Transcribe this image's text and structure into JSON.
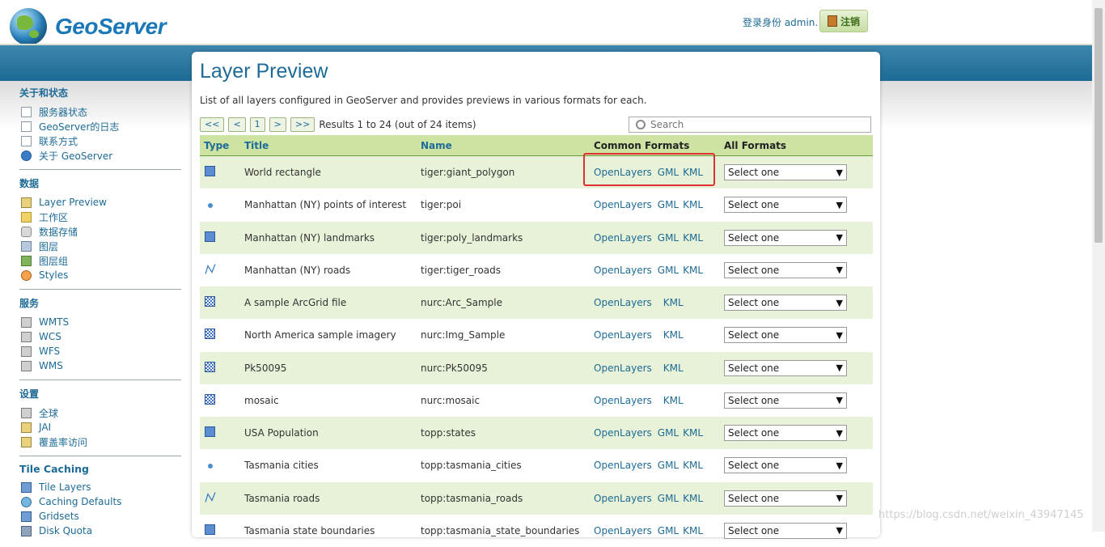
{
  "header": {
    "logo_text": "GeoServer",
    "login_info": "登录身份 admin.",
    "logout_label": "注销"
  },
  "sidebar": {
    "sections": [
      {
        "title": "关于和状态",
        "items": [
          "服务器状态",
          "GeoServer的日志",
          "联系方式",
          "关于 GeoServer"
        ]
      },
      {
        "title": "数据",
        "items": [
          "Layer Preview",
          "工作区",
          "数据存储",
          "图层",
          "图层组",
          "Styles"
        ]
      },
      {
        "title": "服务",
        "items": [
          "WMTS",
          "WCS",
          "WFS",
          "WMS"
        ]
      },
      {
        "title": "设置",
        "items": [
          "全球",
          "JAI",
          "覆盖率访问"
        ]
      },
      {
        "title": "Tile Caching",
        "items": [
          "Tile Layers",
          "Caching Defaults",
          "Gridsets",
          "Disk Quota"
        ]
      }
    ]
  },
  "main": {
    "title": "Layer Preview",
    "description": "List of all layers configured in GeoServer and provides previews in various formats for each.",
    "pager": {
      "first": "<<",
      "prev": "<",
      "page": "1",
      "next": ">",
      "last": ">>",
      "results": "Results 1 to 24 (out of 24 items)"
    },
    "search_placeholder": "Search",
    "columns": {
      "type": "Type",
      "title": "Title",
      "name": "Name",
      "common": "Common Formats",
      "all": "All Formats"
    },
    "select_default": "Select one",
    "rows": [
      {
        "type": "polygon",
        "title": "World rectangle",
        "name": "tiger:giant_polygon",
        "formats": [
          "OpenLayers",
          "GML",
          "KML"
        ]
      },
      {
        "type": "point",
        "title": "Manhattan (NY) points of interest",
        "name": "tiger:poi",
        "formats": [
          "OpenLayers",
          "GML",
          "KML"
        ]
      },
      {
        "type": "polygon",
        "title": "Manhattan (NY) landmarks",
        "name": "tiger:poly_landmarks",
        "formats": [
          "OpenLayers",
          "GML",
          "KML"
        ]
      },
      {
        "type": "line",
        "title": "Manhattan (NY) roads",
        "name": "tiger:tiger_roads",
        "formats": [
          "OpenLayers",
          "GML",
          "KML"
        ]
      },
      {
        "type": "raster",
        "title": "A sample ArcGrid file",
        "name": "nurc:Arc_Sample",
        "formats": [
          "OpenLayers",
          "",
          "KML"
        ]
      },
      {
        "type": "raster",
        "title": "North America sample imagery",
        "name": "nurc:Img_Sample",
        "formats": [
          "OpenLayers",
          "",
          "KML"
        ]
      },
      {
        "type": "raster",
        "title": "Pk50095",
        "name": "nurc:Pk50095",
        "formats": [
          "OpenLayers",
          "",
          "KML"
        ]
      },
      {
        "type": "raster",
        "title": "mosaic",
        "name": "nurc:mosaic",
        "formats": [
          "OpenLayers",
          "",
          "KML"
        ]
      },
      {
        "type": "polygon",
        "title": "USA Population",
        "name": "topp:states",
        "formats": [
          "OpenLayers",
          "GML",
          "KML"
        ]
      },
      {
        "type": "point",
        "title": "Tasmania cities",
        "name": "topp:tasmania_cities",
        "formats": [
          "OpenLayers",
          "GML",
          "KML"
        ]
      },
      {
        "type": "line",
        "title": "Tasmania roads",
        "name": "topp:tasmania_roads",
        "formats": [
          "OpenLayers",
          "GML",
          "KML"
        ]
      },
      {
        "type": "polygon",
        "title": "Tasmania state boundaries",
        "name": "topp:tasmania_state_boundaries",
        "formats": [
          "OpenLayers",
          "GML",
          "KML"
        ]
      }
    ]
  },
  "watermark": "https://blog.csdn.net/weixin_43947145",
  "colors": {
    "accent": "#1d6b96",
    "band": "#2a78a3",
    "header_row": "#cde3a2",
    "row_alt": "#e8f2d8",
    "highlight": "#e03030"
  }
}
